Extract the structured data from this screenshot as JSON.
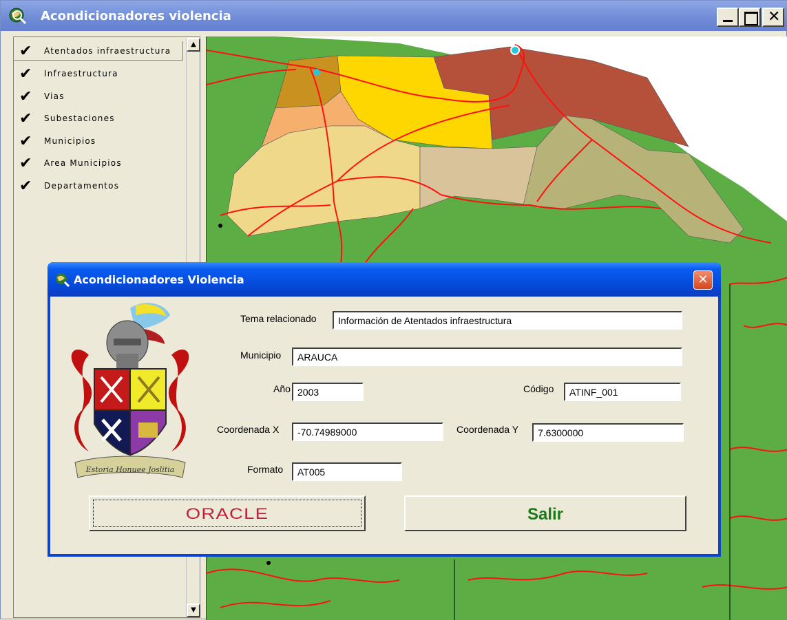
{
  "window": {
    "title": "Acondicionadores violencia"
  },
  "toc": {
    "items": [
      {
        "label": "Atentados infraestructura",
        "checked": true
      },
      {
        "label": "Infraestructura",
        "checked": true
      },
      {
        "label": "Vias",
        "checked": true
      },
      {
        "label": "Subestaciones",
        "checked": true
      },
      {
        "label": "Municipios",
        "checked": true
      },
      {
        "label": "Area Municipios",
        "checked": true
      },
      {
        "label": "Departamentos",
        "checked": true
      }
    ]
  },
  "dialog": {
    "title": "Acondicionadores Violencia",
    "close_glyph": "✕",
    "fields": {
      "tema_label": "Tema relacionado",
      "tema_value": "Información de Atentados infraestructura",
      "municipio_label": "Municipio",
      "municipio_value": "ARAUCA",
      "anio_label": "Año",
      "anio_value": "2003",
      "codigo_label": "Código",
      "codigo_value": "ATINF_001",
      "coordx_label": "Coordenada X",
      "coordx_value": "-70.74989000",
      "coordy_label": "Coordenada Y",
      "coordy_value": "7.6300000",
      "formato_label": "Formato",
      "formato_value": "AT005"
    },
    "buttons": {
      "oracle": "ORACLE",
      "salir": "Salir"
    },
    "crest_motto": "Estoria Honuee Joslitia"
  },
  "colors": {
    "map_green": "#5cad43",
    "road_red": "#ff1010",
    "title_blue": "#0548d8"
  }
}
